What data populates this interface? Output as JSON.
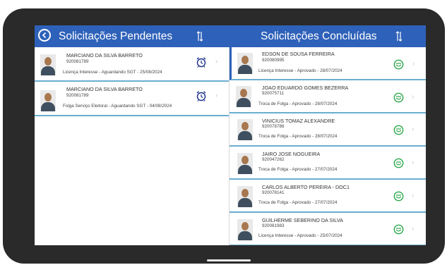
{
  "header": {
    "left_title": "Solicitações Pendentes",
    "right_title": "Solicitações Concluídas",
    "back_icon": "back-arrow-circle-icon",
    "sort_icon": "sort-arrows-icon"
  },
  "pending": [
    {
      "name": "MARCIANO DA SILVA BARRETO",
      "code": "920081789",
      "status": "Licença Interesse - Aguardando SGT - 25/08/2024",
      "icon": "alarm-clock-icon"
    },
    {
      "name": "MARCIANO DA SILVA BARRETO",
      "code": "920081789",
      "status": "Folga Serviço Eleitoral - Aguardando SGT - 04/08/2024",
      "icon": "alarm-clock-icon"
    }
  ],
  "completed": [
    {
      "name": "EDSON DE SOUSA FERREIRA",
      "code": "920080995",
      "status": "Licença Interesse - Aprovado - 28/07/2024",
      "icon": "smiley-icon"
    },
    {
      "name": "JOAO EDUARDO GOMES BEZERRA",
      "code": "920075711",
      "status": "Troca de Folga - Aprovado - 28/07/2024",
      "icon": "smiley-icon"
    },
    {
      "name": "VINICIUS TOMAZ ALEXANDRE",
      "code": "920078788",
      "status": "Troca de Folga - Aprovado - 28/07/2024",
      "icon": "smiley-icon"
    },
    {
      "name": "JAIRO JOSE NOGUEIRA",
      "code": "920047262",
      "status": "Troca de Folga - Aprovado - 27/07/2024",
      "icon": "smiley-icon"
    },
    {
      "name": "CARLOS ALBERTO PEREIRA - DOC1",
      "code": "920078141",
      "status": "Troca de Folga - Aprovado - 27/07/2024",
      "icon": "smiley-icon"
    },
    {
      "name": "GUILHERME SEBERINO DA SILVA",
      "code": "920081983",
      "status": "Licença Interesse - Aprovado - 25/07/2024",
      "icon": "smiley-icon"
    }
  ],
  "colors": {
    "header": "#2e61b9",
    "divider": "#6aaed0",
    "alarm": "#1a2f88",
    "smiley": "#2aa84a"
  }
}
